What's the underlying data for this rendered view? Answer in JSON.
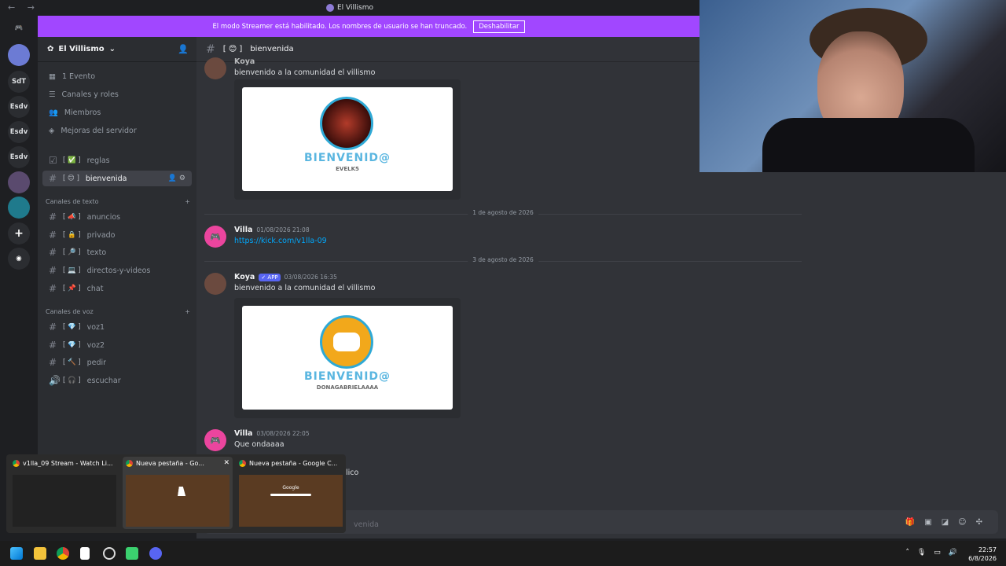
{
  "titlebar": {
    "title": "El Villismo",
    "nav": "← →"
  },
  "banner": {
    "text": "El modo Streamer está habilitado. Los nombres de usuario se han truncado.",
    "button": "Deshabilitar"
  },
  "servers": [
    "SdT",
    "Esdv",
    "Esdv",
    "Esdv"
  ],
  "sidebar": {
    "server_name": "El Villismo",
    "top_items": [
      "1 Evento",
      "Canales y roles",
      "Miembros",
      "Mejoras del servidor"
    ],
    "pinned": [
      {
        "label": "reglas",
        "emoji": "[ ✅ ]"
      },
      {
        "label": "bienvenida",
        "emoji": "[ 😊 ]"
      }
    ],
    "text_category": "Canales de texto",
    "text_channels": [
      {
        "label": "anuncios",
        "emoji": "[ 📣 ]"
      },
      {
        "label": "privado",
        "emoji": "[ 🔒 ]"
      },
      {
        "label": "texto",
        "emoji": "[ 🔎 ]"
      },
      {
        "label": "directos-y-videos",
        "emoji": "[ 💻 ]"
      },
      {
        "label": "chat",
        "emoji": "[ 📌 ]"
      }
    ],
    "voice_category": "Canales de voz",
    "voice_channels": [
      {
        "label": "voz1",
        "emoji": "[ 💎 ]"
      },
      {
        "label": "voz2",
        "emoji": "[ 💎 ]"
      },
      {
        "label": "pedir",
        "emoji": "[ 🔨 ]"
      },
      {
        "label": "escuchar",
        "emoji": "[ 🎧 ]"
      }
    ]
  },
  "channel": {
    "emoji": "[ 😊 ]",
    "name": "bienvenida"
  },
  "messages": {
    "m0": {
      "name": "Koya",
      "text": "bienvenido a la comunidad el villismo",
      "embed_sub": "EVELK5"
    },
    "date1": "1 de agosto de 2026",
    "m1": {
      "name": "Villa",
      "time": "01/08/2026 21:08",
      "link": "https://kick.com/v1lla-09"
    },
    "date2": "3 de agosto de 2026",
    "m2": {
      "name": "Koya",
      "badge": "✓ APP",
      "time": "03/08/2026 16:35",
      "text": "bienvenido a la comunidad el villismo",
      "embed_sub": "DONAGABRIELAAAA"
    },
    "m3": {
      "name": "Villa",
      "time": "03/08/2026 22:05",
      "text": "Que ondaaaa"
    },
    "m3_tail": "lico",
    "embed_title": "BIENVENID@"
  },
  "composer": {
    "placeholder": "venida"
  },
  "previews": [
    {
      "title": "v1lla_09 Stream - Watch Li..."
    },
    {
      "title": "Nueva pestaña - Go..."
    },
    {
      "title": "Nueva pestaña - Google C...",
      "thumb_label": "Google"
    }
  ],
  "clock": {
    "time": "22:57",
    "date": "6/8/2026"
  }
}
